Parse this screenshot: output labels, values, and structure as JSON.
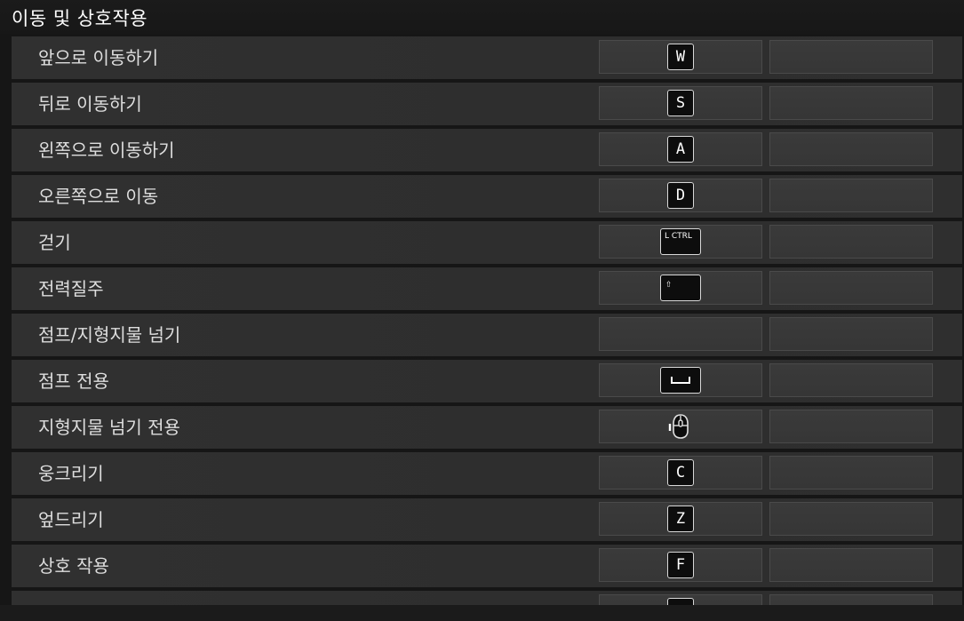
{
  "section": {
    "title": "이동 및 상호작용"
  },
  "rows": [
    {
      "label": "앞으로 이동하기",
      "primary_key": "W"
    },
    {
      "label": "뒤로 이동하기",
      "primary_key": "S"
    },
    {
      "label": "왼쪽으로 이동하기",
      "primary_key": "A"
    },
    {
      "label": "오른쪽으로 이동",
      "primary_key": "D"
    },
    {
      "label": "걷기",
      "primary_key": "L CTRL"
    },
    {
      "label": "전력질주",
      "primary_key": "⇧"
    },
    {
      "label": "점프/지형지물 넘기",
      "primary_key": ""
    },
    {
      "label": "점프 전용",
      "primary_key": "space-bar-icon"
    },
    {
      "label": "지형지물 넘기 전용",
      "primary_key": "mouse-side-button-icon"
    },
    {
      "label": "웅크리기",
      "primary_key": "C"
    },
    {
      "label": "엎드리기",
      "primary_key": "Z"
    },
    {
      "label": "상호 작용",
      "primary_key": "F"
    },
    {
      "label": "",
      "primary_key": ""
    }
  ],
  "colors": {
    "background": "#161616",
    "row_background": "#2f2f2f",
    "slot_background": "#383838",
    "keycap_background": "#0d0d0d",
    "keycap_border": "#d8d8d8",
    "text": "#dedede"
  }
}
